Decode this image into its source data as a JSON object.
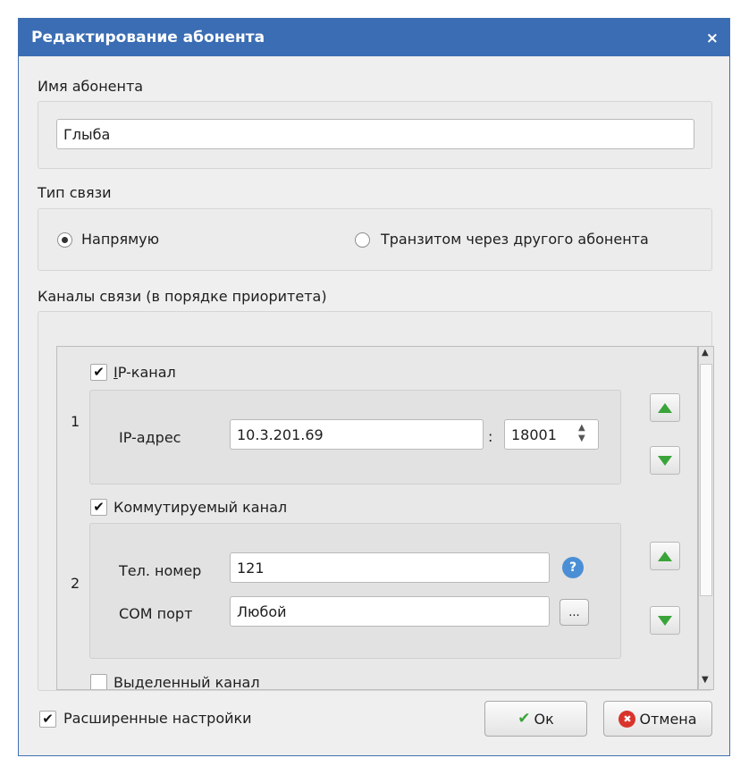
{
  "dialog": {
    "title": "Редактирование абонента",
    "close_label": "×"
  },
  "name_section": {
    "label": "Имя абонента",
    "value": "Глыба"
  },
  "connection_type": {
    "label": "Тип связи",
    "options": [
      {
        "label": "Напрямую",
        "selected": true
      },
      {
        "label": "Транзитом через другого абонента",
        "selected": false
      }
    ]
  },
  "channels": {
    "label": "Каналы связи (в порядке приоритета)",
    "items": [
      {
        "index": "1",
        "checked": true,
        "check_mark": "✔",
        "label_prefix": "I",
        "label_rest": "P-канал",
        "ip_label": "IP-адрес",
        "ip_value": "10.3.201.69",
        "separator": ":",
        "port_value": "18001"
      },
      {
        "index": "2",
        "checked": true,
        "check_mark": "✔",
        "label": "Коммутируемый канал",
        "phone_label": "Тел. номер",
        "phone_value": "121",
        "help_icon_glyph": "?",
        "com_label": "COM порт",
        "com_value": "Любой",
        "browse_label": "..."
      },
      {
        "checked": false,
        "label": "Выделенный канал"
      }
    ]
  },
  "footer": {
    "advanced_label": "Расширенные настройки",
    "advanced_checked": true,
    "check_mark": "✔",
    "ok_label": "Ок",
    "ok_icon_glyph": "✔",
    "cancel_label": "Отмена",
    "cancel_icon_glyph": "✖"
  },
  "colors": {
    "titlebar": "#3b6db4",
    "accent_green": "#3aa43a",
    "cancel_red": "#d9342b",
    "help_blue": "#4a8fd6"
  }
}
